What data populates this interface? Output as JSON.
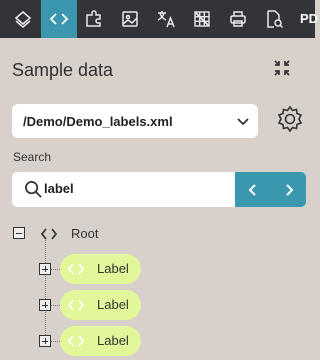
{
  "toolbar": {
    "buttons": [
      {
        "icon": "layers-icon",
        "active": false
      },
      {
        "icon": "code-icon",
        "active": true
      },
      {
        "icon": "puzzle-icon",
        "active": false
      },
      {
        "icon": "image-icon",
        "active": false
      },
      {
        "icon": "translate-icon",
        "active": false
      },
      {
        "icon": "grid-icon",
        "active": false
      },
      {
        "icon": "print-icon",
        "active": false
      },
      {
        "icon": "preview-doc-icon",
        "active": false
      }
    ],
    "overflow_text": "PD"
  },
  "panel": {
    "title": "Sample data",
    "file_select": {
      "value": "/Demo/Demo_labels.xml"
    },
    "search": {
      "label": "Search",
      "value": "label"
    }
  },
  "tree": {
    "root_label": "Root",
    "children": [
      {
        "label": "Label"
      },
      {
        "label": "Label"
      },
      {
        "label": "Label"
      }
    ]
  },
  "colors": {
    "toolbar_bg": "#33343a",
    "accent": "#3a97ae",
    "panel_bg": "#d8d0cb",
    "highlight": "#e2f79a"
  }
}
